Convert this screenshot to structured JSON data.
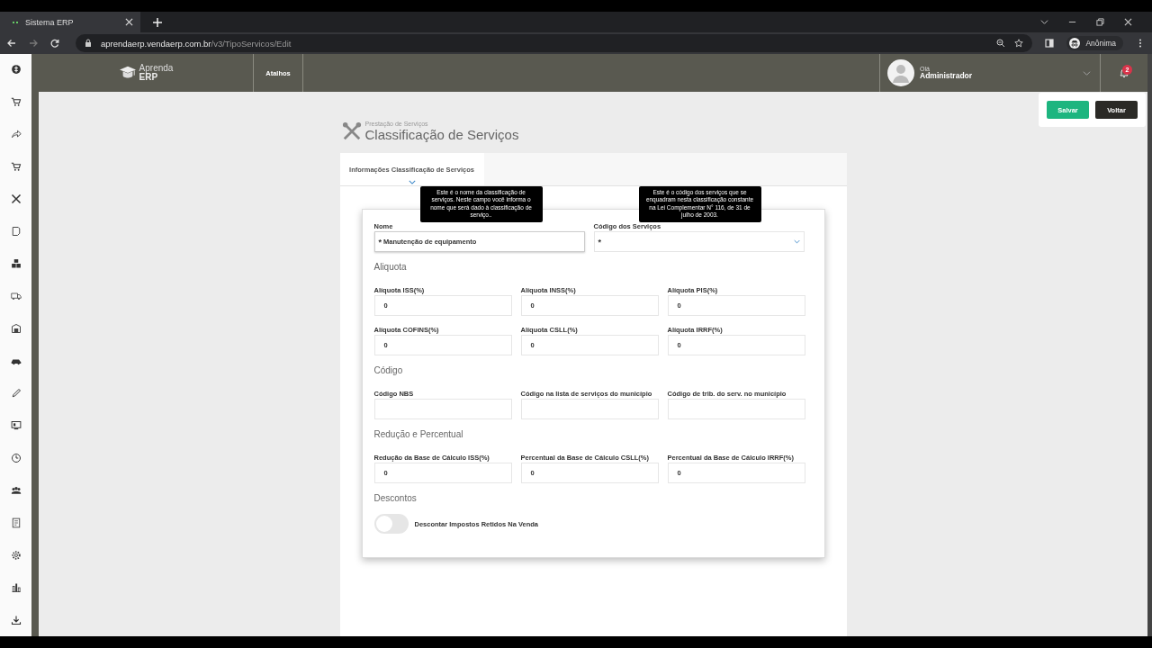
{
  "browser": {
    "tab_title": "Sistema ERP",
    "url_host": "aprendaerp.vendaerp.com.br",
    "url_path": "/v3/TipoServicos/Edit",
    "profile": "Anônima"
  },
  "header": {
    "logo_top": "Aprenda",
    "logo_bottom": "ERP",
    "shortcuts": "Atalhos",
    "greeting": "Olá",
    "user": "Administrador",
    "notifications": "2"
  },
  "actions": [
    {
      "label": "Salvar",
      "kind": "primary"
    },
    {
      "label": "Voltar",
      "kind": "dark"
    }
  ],
  "breadcrumb": "Prestação de Serviços",
  "title": "Classificação de Serviços",
  "tabs": [
    {
      "label": "Informações Classificação de Serviços",
      "selected": true
    }
  ],
  "tooltips": [
    "Este é o nome da classificação de serviços. Neste campo você informa o nome que será dado à classificação de serviço..",
    "Este é o código dos serviços que se enquadram nesta classificação constante na Lei Complementar N° 116, de 31 de julho de 2003."
  ],
  "top_fields": [
    {
      "label": "Nome",
      "required_mark": "*",
      "value": "Manutenção de equipamento",
      "kind": "text"
    },
    {
      "label": "Código dos Serviços",
      "required_mark": "*",
      "kind": "select"
    }
  ],
  "sections": [
    {
      "title": "Aliquota",
      "fields": [
        {
          "label": "Alíquota ISS(%)",
          "value": "0"
        },
        {
          "label": "Alíquota INSS(%)",
          "value": "0"
        },
        {
          "label": "Alíquota PIS(%)",
          "value": "0"
        },
        {
          "label": "Alíquota COFINS(%)",
          "value": "0"
        },
        {
          "label": "Alíquota CSLL(%)",
          "value": "0"
        },
        {
          "label": "Alíquota IRRF(%)",
          "value": "0"
        }
      ]
    },
    {
      "title": "Código",
      "fields": [
        {
          "label": "Código NBS"
        },
        {
          "label": "Código na lista de serviços do município"
        },
        {
          "label": "Código de trib. do serv. no município"
        }
      ]
    },
    {
      "title": "Redução e Percentual",
      "fields": [
        {
          "label": "Redução da Base de Cálculo ISS(%)",
          "value": "0"
        },
        {
          "label": "Percentual da Base de Cálculo CSLL(%)",
          "value": "0"
        },
        {
          "label": "Percentual da Base de Cálculo IRRF(%)",
          "value": "0"
        }
      ]
    }
  ],
  "discount": {
    "title": "Descontos",
    "label": "Descontar Impostos Retidos Na Venda",
    "on": false
  }
}
